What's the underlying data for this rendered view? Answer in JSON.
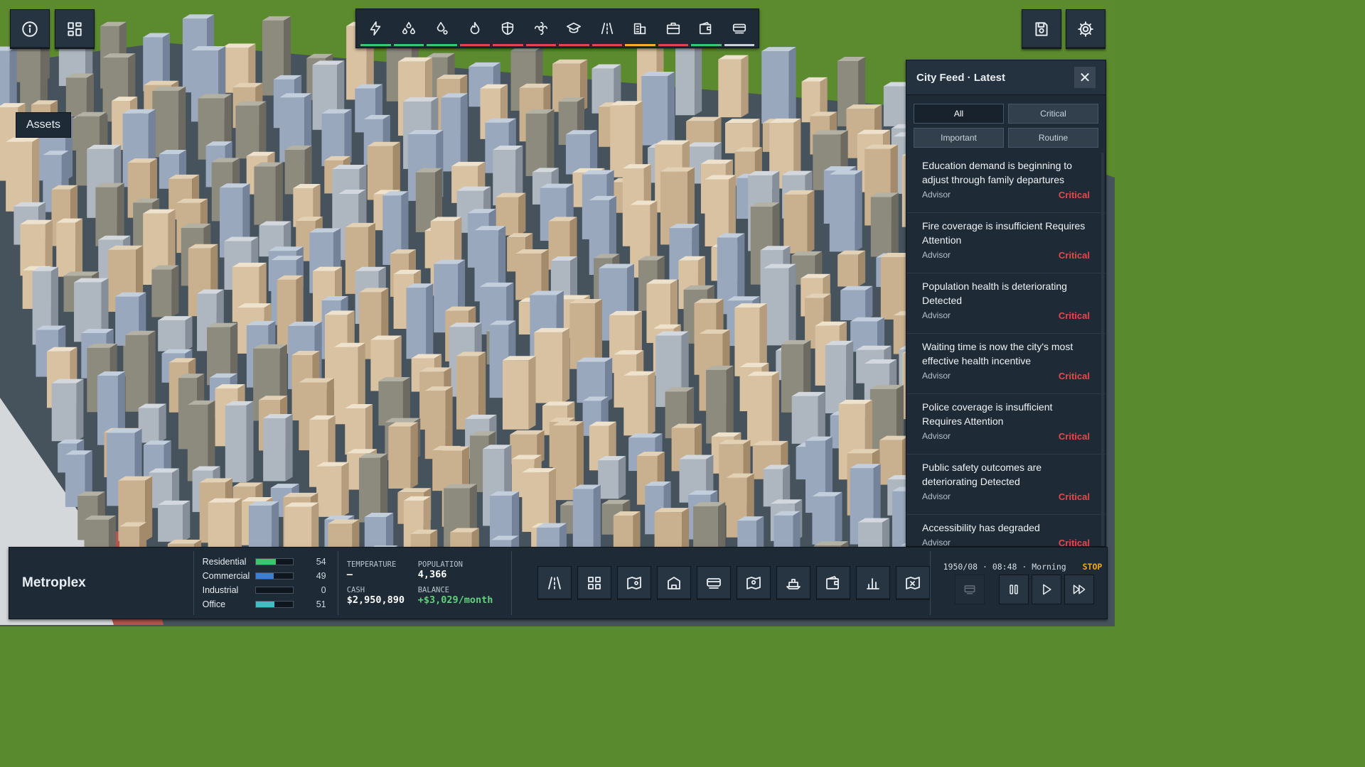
{
  "top_left": {
    "info_button": "info-icon",
    "layout_button": "dashboard-icon"
  },
  "toolbar": [
    {
      "icon": "lightning-icon",
      "status_color": "#3ec46d"
    },
    {
      "icon": "water-drops-icon",
      "status_color": "#3ec46d"
    },
    {
      "icon": "sewage-drop-icon",
      "status_color": "#3ec46d"
    },
    {
      "icon": "fire-icon",
      "status_color": "#e0474c"
    },
    {
      "icon": "police-shield-icon",
      "status_color": "#e0474c"
    },
    {
      "icon": "health-icon",
      "status_color": "#e0474c"
    },
    {
      "icon": "education-cap-icon",
      "status_color": "#e0474c"
    },
    {
      "icon": "road-icon",
      "status_color": "#e0474c"
    },
    {
      "icon": "buildings-icon",
      "status_color": "#f0b030"
    },
    {
      "icon": "briefcase-icon",
      "status_color": "#e0474c"
    },
    {
      "icon": "wallet-icon",
      "status_color": "#3ec46d"
    },
    {
      "icon": "transit-icon",
      "status_color": "#c9d2da"
    }
  ],
  "top_right": {
    "save_button": "save-icon",
    "settings_button": "gear-icon"
  },
  "assets_label": "Assets",
  "feed": {
    "title": "City Feed · Latest",
    "close": "✕",
    "filters": [
      {
        "label": "All",
        "active": true
      },
      {
        "label": "Critical",
        "active": false
      },
      {
        "label": "Important",
        "active": false
      },
      {
        "label": "Routine",
        "active": false
      }
    ],
    "items": [
      {
        "text": "Education demand is beginning to adjust through family departures",
        "source": "Advisor",
        "severity": "Critical"
      },
      {
        "text": "Fire coverage is insufficient Requires Attention",
        "source": "Advisor",
        "severity": "Critical"
      },
      {
        "text": "Population health is deteriorating Detected",
        "source": "Advisor",
        "severity": "Critical"
      },
      {
        "text": "Waiting time is now the city's most effective health incentive",
        "source": "Advisor",
        "severity": "Critical"
      },
      {
        "text": "Police coverage is insufficient Requires Attention",
        "source": "Advisor",
        "severity": "Critical"
      },
      {
        "text": "Public safety outcomes are deteriorating Detected",
        "source": "Advisor",
        "severity": "Critical"
      },
      {
        "text": "Accessibility has degraded",
        "source": "Advisor",
        "severity": "Critical"
      }
    ]
  },
  "bottom": {
    "city_name": "Metroplex",
    "zones": [
      {
        "label": "Residential",
        "value": "54",
        "level": 0.54,
        "color": "#3ec46d"
      },
      {
        "label": "Commercial",
        "value": "49",
        "level": 0.49,
        "color": "#3d7fd6"
      },
      {
        "label": "Industrial",
        "value": "0",
        "level": 0.0,
        "color": "#d6a43d"
      },
      {
        "label": "Office",
        "value": "51",
        "level": 0.51,
        "color": "#3fbfc4"
      }
    ],
    "stats": {
      "temperature_label": "TEMPERATURE",
      "temperature_value": "—",
      "population_label": "POPULATION",
      "population_value": "4,366",
      "cash_label": "CASH",
      "cash_value": "$2,950,890",
      "balance_label": "BALANCE",
      "balance_value": "+$3,029/month"
    },
    "tools": [
      "road-tool-icon",
      "zones-grid-icon",
      "map-pin-icon",
      "building-tool-icon",
      "transit-tool-icon",
      "district-map-icon",
      "ship-icon",
      "budget-wallet-icon",
      "statistics-icon",
      "map-view-icon"
    ],
    "time": {
      "datetime": "1950/08 · 08:48 · Morning",
      "stop": "STOP"
    }
  }
}
